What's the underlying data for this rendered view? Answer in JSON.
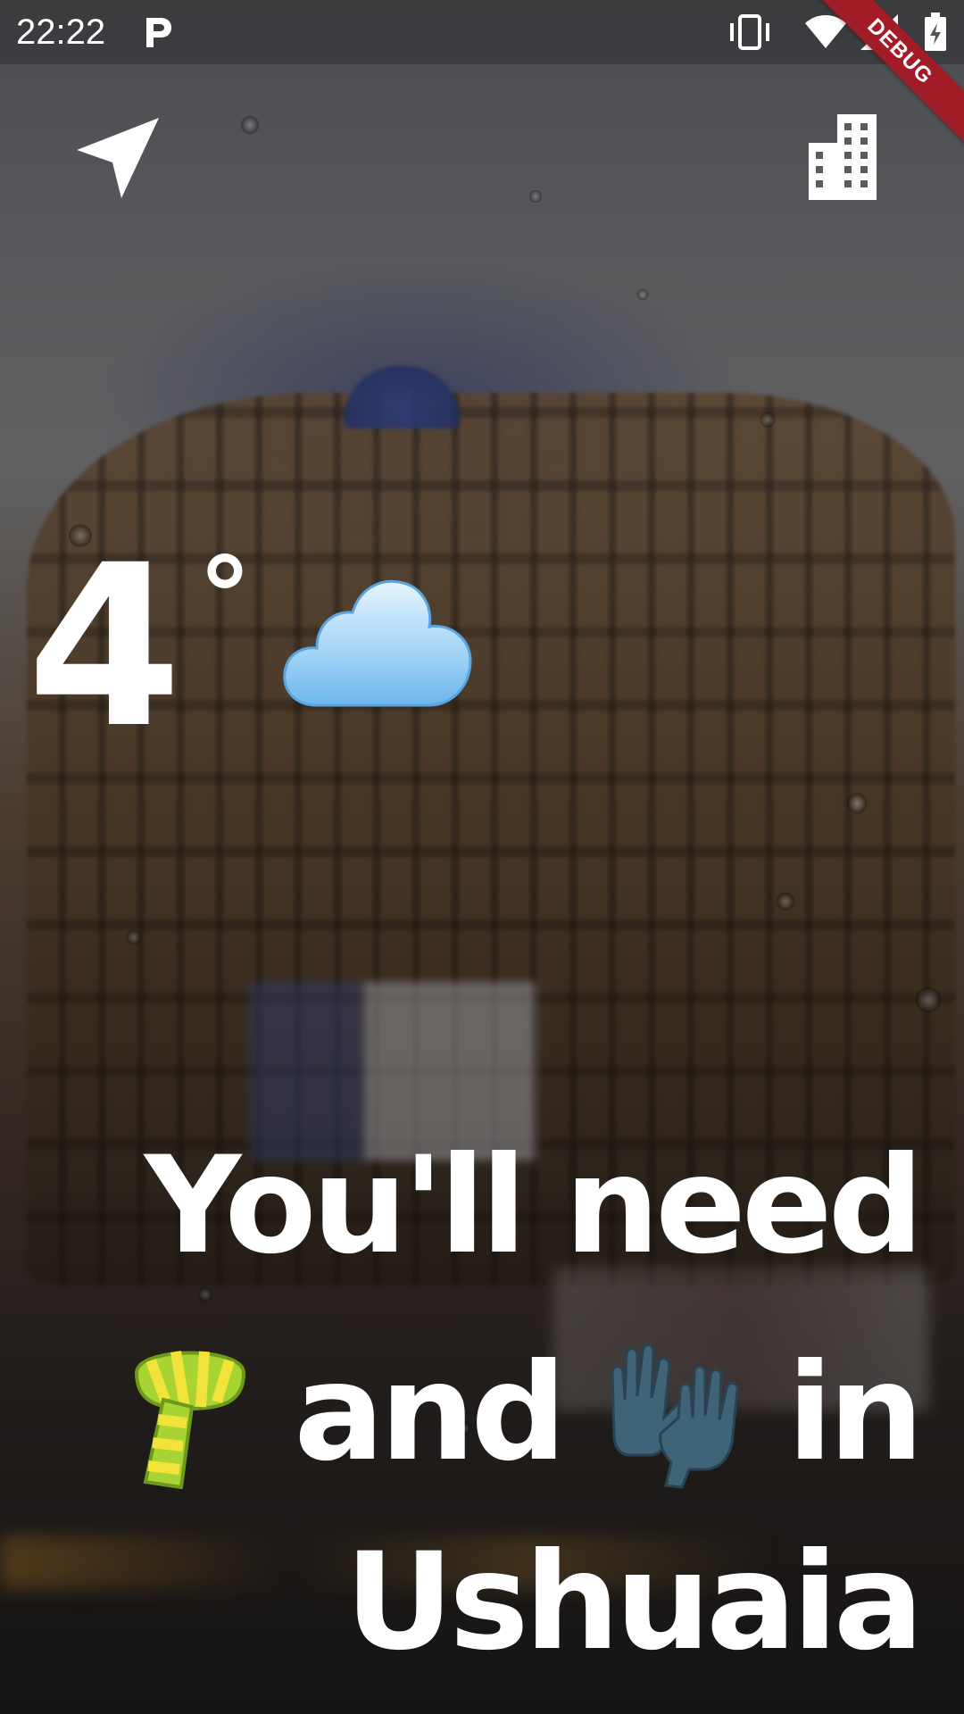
{
  "status_bar": {
    "time": "22:22",
    "notification_icon": "parking-p-icon",
    "icons": [
      "vibrate-icon",
      "wifi-icon",
      "signal-icon",
      "battery-charging-icon"
    ]
  },
  "debug_banner": "DEBUG",
  "top_bar": {
    "left_icon": "navigation-arrow-icon",
    "right_icon": "city-building-icon"
  },
  "weather": {
    "temperature": "4",
    "degree_symbol": "°",
    "condition_icon": "cloud-icon"
  },
  "message": {
    "line1": "You'll need",
    "line2_emoji1": "scarf-emoji",
    "line2_word1": "and",
    "line2_emoji2": "gloves-emoji",
    "line2_word2": "in",
    "line3": "Ushuaia"
  },
  "colors": {
    "text": "#ffffff",
    "debug_ribbon": "#a11c26",
    "cloud": "#8fc9f2"
  }
}
